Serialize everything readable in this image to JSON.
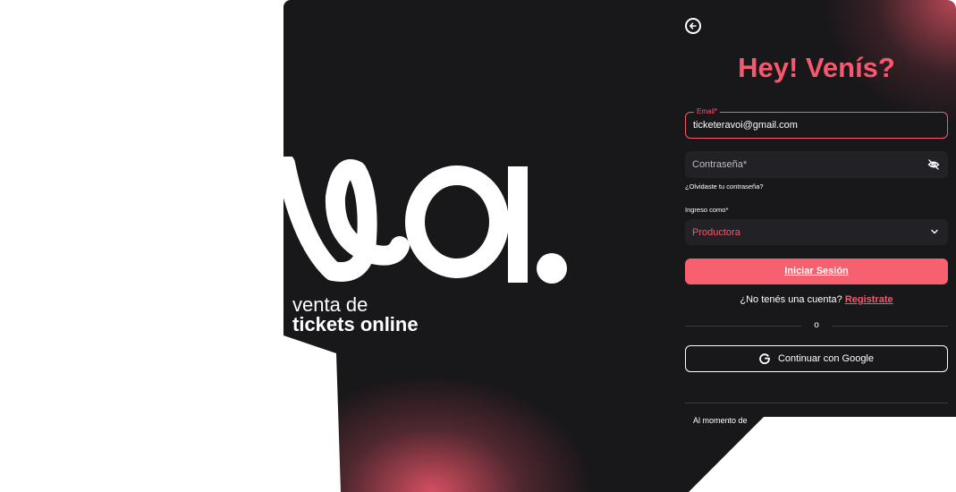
{
  "brand": {
    "tagline_line1": "venta de",
    "tagline_line2": "tickets online",
    "accent": "#f7586d",
    "background": "#18171a"
  },
  "header": {
    "back_icon": "arrow-left-circle-icon",
    "title": "Hey! Venís?"
  },
  "form": {
    "email": {
      "label": "Email*",
      "value": "ticketeravoi@gmail.com"
    },
    "password": {
      "placeholder": "Contraseña*",
      "icon": "eye-off-icon"
    },
    "forgot_link": "¿Olvidaste tu contraseña?",
    "role": {
      "label": "Ingreso como*",
      "value": "Productora",
      "icon": "chevron-down-icon"
    },
    "submit_label": "Iniciar Sesión"
  },
  "signup": {
    "prompt": "¿No tenés una cuenta?",
    "link": "Registrate"
  },
  "divider": {
    "label": "o"
  },
  "google": {
    "label": "Continuar con Google",
    "icon": "google-icon"
  },
  "legal": {
    "text": "Al momento de"
  }
}
